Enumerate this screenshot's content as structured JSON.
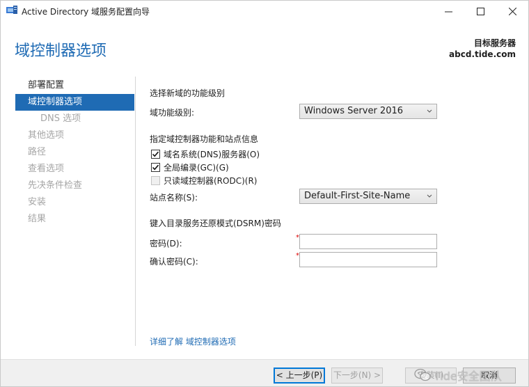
{
  "window": {
    "title": "Active Directory 域服务配置向导",
    "minimize_glyph": "—",
    "maximize_glyph": "☐",
    "close_glyph": "✕"
  },
  "header": {
    "page_title": "域控制器选项",
    "target_server_label": "目标服务器",
    "target_server_name": "abcd.tide.com"
  },
  "nav": {
    "items": [
      {
        "label": "部署配置",
        "state": "done"
      },
      {
        "label": "域控制器选项",
        "state": "active"
      },
      {
        "label": "DNS 选项",
        "state": "pending-sub"
      },
      {
        "label": "其他选项",
        "state": "pending"
      },
      {
        "label": "路径",
        "state": "pending"
      },
      {
        "label": "查看选项",
        "state": "pending"
      },
      {
        "label": "先决条件检查",
        "state": "pending"
      },
      {
        "label": "安装",
        "state": "pending"
      },
      {
        "label": "结果",
        "state": "pending"
      }
    ]
  },
  "content": {
    "func_level_heading": "选择新域的功能级别",
    "domain_level_label": "域功能级别:",
    "domain_level_value": "Windows Server 2016",
    "capabilities_heading": "指定域控制器功能和站点信息",
    "dns_server": {
      "label": "域名系统(DNS)服务器(O)",
      "checked": true
    },
    "global_catalog": {
      "label": "全局编录(GC)(G)",
      "checked": true
    },
    "rodc": {
      "label": "只读域控制器(RODC)(R)",
      "checked": false
    },
    "site_name_label": "站点名称(S):",
    "site_name_value": "Default-First-Site-Name",
    "dsrm_heading": "键入目录服务还原模式(DSRM)密码",
    "password_label": "密码(D):",
    "confirm_password_label": "确认密码(C):",
    "required_marker": "*",
    "learn_more_link": "详细了解 域控制器选项"
  },
  "footer": {
    "prev_button": "< 上一步(P)",
    "next_button": "下一步(N) >",
    "install_button": "安装(I)",
    "cancel_button": "取消",
    "watermark_text": "Tide安全团队"
  },
  "colors": {
    "accent": "#1f6bb4",
    "required": "#dd0000"
  }
}
